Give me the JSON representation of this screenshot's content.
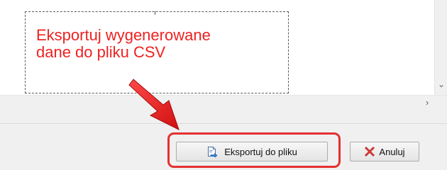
{
  "annotation": {
    "line1": "Eksportuj wygenerowane",
    "line2": "dane do pliku CSV",
    "color": "#ee2222"
  },
  "scrollbars": {
    "vertical_arrow_icon": "chevron-down-icon",
    "horizontal_arrow_icon": "chevron-right-icon",
    "vertical_arrow_glyph": "⌄",
    "horizontal_arrow_glyph": "›"
  },
  "buttons": {
    "export": {
      "label": "Eksportuj do pliku",
      "icon": "export-file-icon"
    },
    "cancel": {
      "label": "Anuluj",
      "icon": "red-x-icon"
    }
  }
}
